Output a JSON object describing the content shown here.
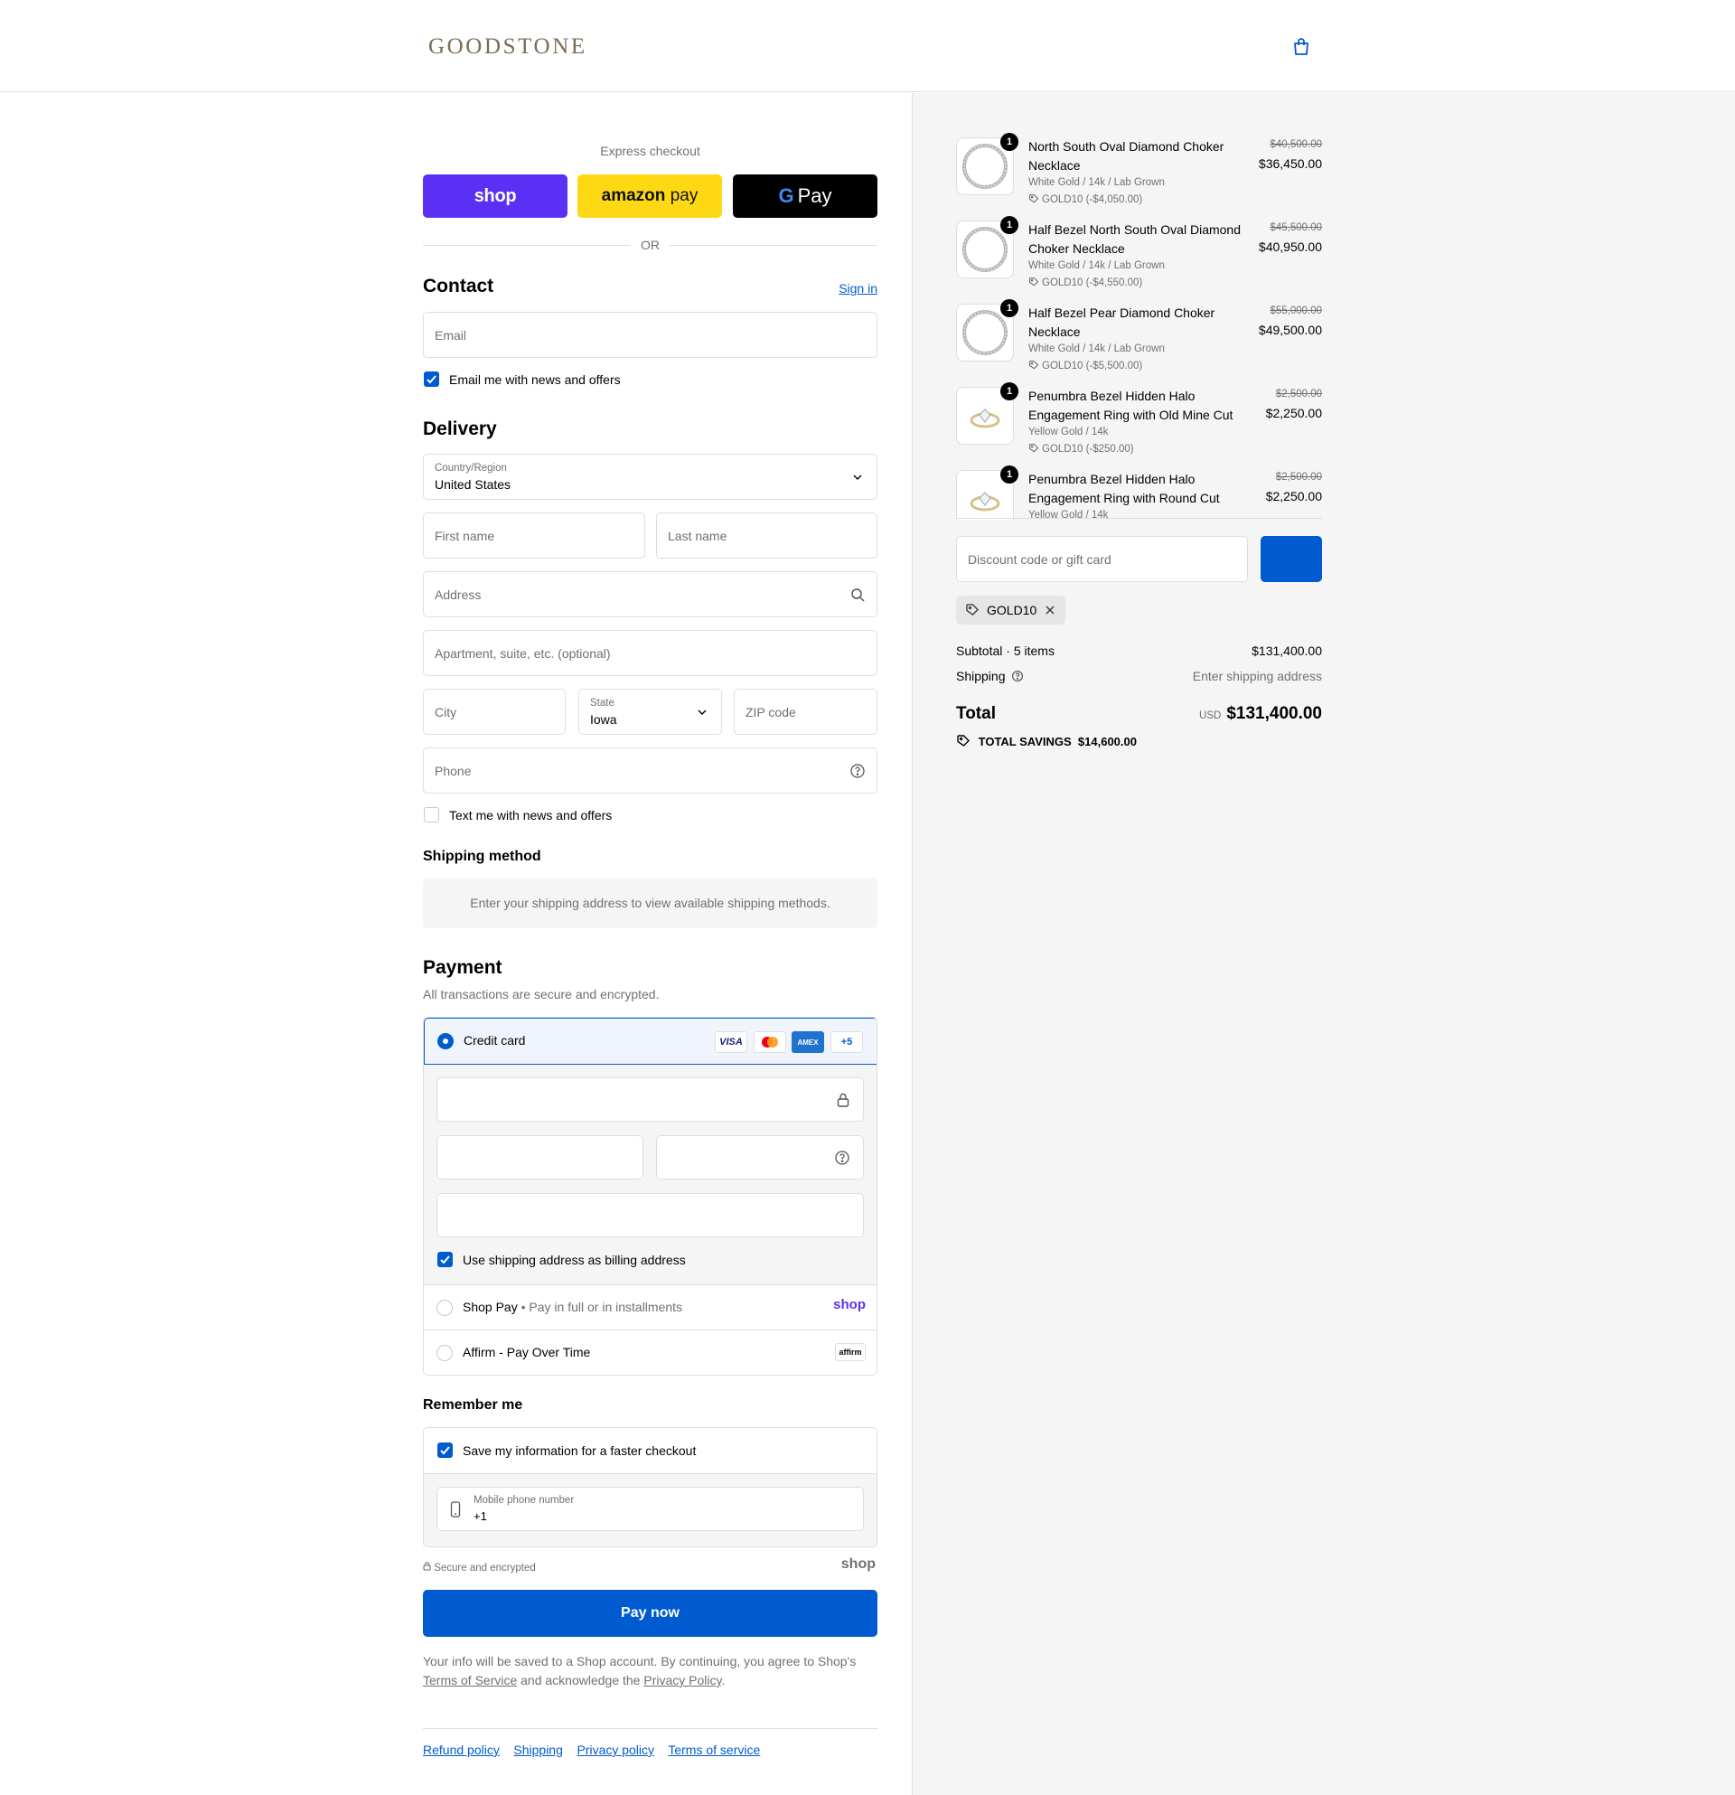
{
  "header": {
    "logo": "GOODSTONE"
  },
  "express": {
    "title": "Express checkout",
    "shop_label": "shop",
    "amazon_label_bold": "amazon",
    "amazon_label": "pay",
    "gpay_label": "Pay",
    "or": "OR"
  },
  "contact": {
    "heading": "Contact",
    "sign_in": "Sign in",
    "email_placeholder": "Email",
    "news_label": "Email me with news and offers"
  },
  "delivery": {
    "heading": "Delivery",
    "country_label": "Country/Region",
    "country_value": "United States",
    "first_name": "First name",
    "last_name": "Last name",
    "address": "Address",
    "apartment": "Apartment, suite, etc. (optional)",
    "city": "City",
    "state_label": "State",
    "state_value": "Iowa",
    "zip": "ZIP code",
    "phone": "Phone",
    "text_label": "Text me with news and offers"
  },
  "shipping_method": {
    "heading": "Shipping method",
    "message": "Enter your shipping address to view available shipping methods."
  },
  "payment": {
    "heading": "Payment",
    "subtitle": "All transactions are secure and encrypted.",
    "credit_card": "Credit card",
    "card_more": "+5",
    "billing_label": "Use shipping address as billing address",
    "shop_pay": "Shop Pay",
    "shop_pay_sub": "Pay in full or in installments",
    "shop_logo": "shop",
    "affirm": "Affirm - Pay Over Time",
    "affirm_logo": "affirm"
  },
  "remember": {
    "heading": "Remember me",
    "save_label": "Save my information for a faster checkout",
    "mobile_label": "Mobile phone number",
    "mobile_value": "+1",
    "secure": "Secure and encrypted",
    "shop_logo": "shop"
  },
  "pay_now": "Pay now",
  "legal": {
    "line1": "Your info will be saved to a Shop account. By continuing, you agree to Shop's",
    "tos": "Terms of Service",
    "mid": " and acknowledge the ",
    "privacy": "Privacy Policy",
    "end": "."
  },
  "footer": [
    "Refund policy",
    "Shipping",
    "Privacy policy",
    "Terms of service"
  ],
  "items": [
    {
      "qty": "1",
      "name": "North South Oval Diamond Choker Necklace",
      "variant": "White Gold / 14k / Lab Grown",
      "discount": "GOLD10 (-$4,050.00)",
      "original": "$40,500.00",
      "price": "$36,450.00",
      "kind": "necklace"
    },
    {
      "qty": "1",
      "name": "Half Bezel North South Oval Diamond Choker Necklace",
      "variant": "White Gold / 14k / Lab Grown",
      "discount": "GOLD10 (-$4,550.00)",
      "original": "$45,500.00",
      "price": "$40,950.00",
      "kind": "necklace"
    },
    {
      "qty": "1",
      "name": "Half Bezel Pear Diamond Choker Necklace",
      "variant": "White Gold / 14k / Lab Grown",
      "discount": "GOLD10 (-$5,500.00)",
      "original": "$55,000.00",
      "price": "$49,500.00",
      "kind": "necklace"
    },
    {
      "qty": "1",
      "name": "Penumbra Bezel Hidden Halo Engagement Ring with Old Mine Cut",
      "variant": "Yellow Gold / 14k",
      "discount": "GOLD10 (-$250.00)",
      "original": "$2,500.00",
      "price": "$2,250.00",
      "kind": "ring"
    },
    {
      "qty": "1",
      "name": "Penumbra Bezel Hidden Halo Engagement Ring with Round Cut",
      "variant": "Yellow Gold / 14k",
      "discount": "",
      "original": "$2,500.00",
      "price": "$2,250.00",
      "kind": "ring"
    }
  ],
  "summary": {
    "discount_placeholder": "Discount code or gift card",
    "applied_code": "GOLD10",
    "subtotal_label": "Subtotal · 5 items",
    "subtotal_value": "$131,400.00",
    "shipping_label": "Shipping",
    "shipping_value": "Enter shipping address",
    "total_label": "Total",
    "currency": "USD",
    "total_value": "$131,400.00",
    "savings_label": "TOTAL SAVINGS",
    "savings_value": "$14,600.00"
  },
  "colors": {
    "accent": "#005bd1",
    "shop_purple": "#5a31f4",
    "amazon_yellow": "#ffd814"
  }
}
